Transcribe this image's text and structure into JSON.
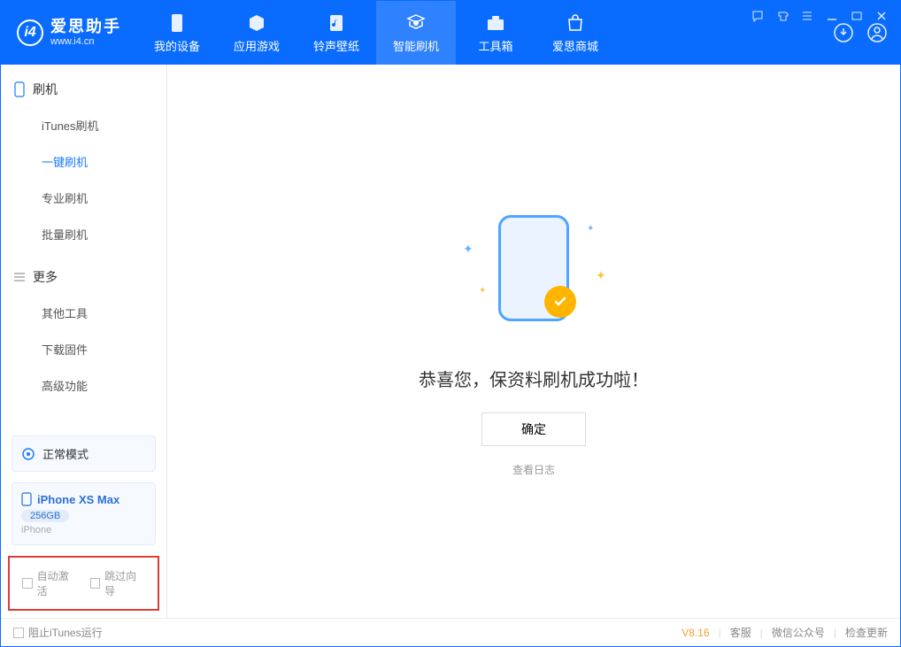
{
  "app": {
    "title": "爱思助手",
    "url": "www.i4.cn",
    "logo_letter": "i4"
  },
  "nav": {
    "tabs": [
      {
        "label": "我的设备",
        "icon": "device-icon"
      },
      {
        "label": "应用游戏",
        "icon": "cube-icon"
      },
      {
        "label": "铃声壁纸",
        "icon": "music-icon"
      },
      {
        "label": "智能刷机",
        "icon": "refresh-icon",
        "active": true
      },
      {
        "label": "工具箱",
        "icon": "toolbox-icon"
      },
      {
        "label": "爱思商城",
        "icon": "shop-icon"
      }
    ]
  },
  "titlebar_icons": {
    "download": "download-icon",
    "user": "user-icon"
  },
  "sidebar": {
    "sections": [
      {
        "header": "刷机",
        "icon": "phone-icon",
        "items": [
          {
            "label": "iTunes刷机"
          },
          {
            "label": "一键刷机",
            "active": true
          },
          {
            "label": "专业刷机"
          },
          {
            "label": "批量刷机"
          }
        ]
      },
      {
        "header": "更多",
        "icon": "menu-icon",
        "items": [
          {
            "label": "其他工具"
          },
          {
            "label": "下载固件"
          },
          {
            "label": "高级功能"
          }
        ]
      }
    ],
    "mode": {
      "label": "正常模式"
    },
    "device": {
      "name": "iPhone XS Max",
      "storage": "256GB",
      "type": "iPhone"
    },
    "checkboxes": [
      {
        "label": "自动激活"
      },
      {
        "label": "跳过向导"
      }
    ]
  },
  "main": {
    "success_text": "恭喜您，保资料刷机成功啦！",
    "ok_button": "确定",
    "log_link": "查看日志"
  },
  "statusbar": {
    "block_itunes": "阻止iTunes运行",
    "version": "V8.16",
    "links": [
      "客服",
      "微信公众号",
      "检查更新"
    ]
  }
}
